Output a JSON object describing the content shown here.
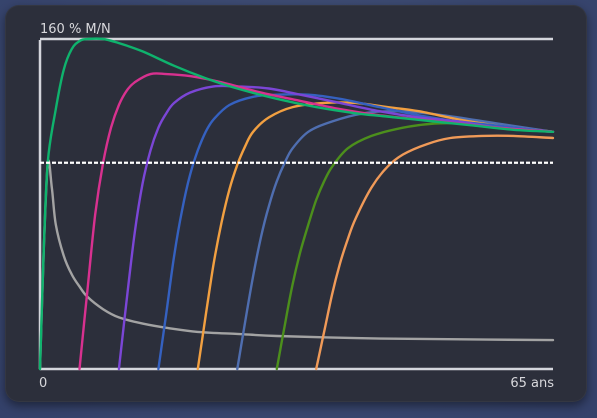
{
  "chart_data": {
    "type": "line",
    "title": "",
    "ylabel": "160 % M/N",
    "x_start_label": "0",
    "x_end_label": "65 ans",
    "xlim": [
      0,
      65
    ],
    "ylim": [
      0,
      160
    ],
    "reference_line": 100,
    "colors": {
      "axis": "#d4d6dc",
      "reference": "#ffffff",
      "grey": "#a3a3a3",
      "series": [
        "#0fb36d",
        "#d8318f",
        "#7b46d6",
        "#3561c0",
        "#f2a041",
        "#4f6eb0",
        "#4c8f1c",
        "#f09a58"
      ]
    },
    "series": [
      {
        "values": [
          [
            0,
            0
          ],
          [
            0.5,
            60
          ],
          [
            1,
            101
          ],
          [
            2,
            126
          ],
          [
            3,
            145
          ],
          [
            4,
            155
          ],
          [
            5,
            159
          ],
          [
            6,
            160
          ],
          [
            8,
            160
          ],
          [
            10,
            158
          ],
          [
            13,
            154
          ],
          [
            17,
            147
          ],
          [
            21,
            141
          ],
          [
            25,
            136
          ],
          [
            30,
            131
          ],
          [
            35,
            127
          ],
          [
            40,
            124
          ],
          [
            45,
            122
          ],
          [
            50,
            120
          ],
          [
            55,
            118
          ],
          [
            60,
            116
          ],
          [
            65,
            115
          ]
        ]
      },
      {
        "values": [
          [
            5,
            0
          ],
          [
            6,
            38
          ],
          [
            7,
            75
          ],
          [
            8,
            100
          ],
          [
            9,
            117
          ],
          [
            10,
            128
          ],
          [
            11,
            135
          ],
          [
            12,
            139
          ],
          [
            14,
            143
          ],
          [
            16,
            143
          ],
          [
            19,
            142
          ],
          [
            23,
            139
          ],
          [
            28,
            134
          ],
          [
            33,
            130
          ],
          [
            38,
            126
          ],
          [
            43,
            123
          ],
          [
            48,
            121
          ],
          [
            53,
            119
          ],
          [
            58,
            117
          ],
          [
            65,
            115
          ]
        ]
      },
      {
        "values": [
          [
            10,
            0
          ],
          [
            11,
            34
          ],
          [
            12,
            66
          ],
          [
            13,
            90
          ],
          [
            14,
            106
          ],
          [
            15,
            117
          ],
          [
            16,
            124
          ],
          [
            17,
            129
          ],
          [
            19,
            134
          ],
          [
            22,
            137
          ],
          [
            25,
            137
          ],
          [
            29,
            136
          ],
          [
            33,
            133
          ],
          [
            38,
            129
          ],
          [
            43,
            125
          ],
          [
            48,
            122
          ],
          [
            53,
            120
          ],
          [
            58,
            117
          ],
          [
            65,
            115
          ]
        ]
      },
      {
        "values": [
          [
            15,
            0
          ],
          [
            16,
            27
          ],
          [
            17,
            55
          ],
          [
            18,
            77
          ],
          [
            19,
            94
          ],
          [
            20,
            106
          ],
          [
            21,
            115
          ],
          [
            22,
            121
          ],
          [
            24,
            128
          ],
          [
            27,
            132
          ],
          [
            30,
            133
          ],
          [
            34,
            133
          ],
          [
            38,
            131
          ],
          [
            43,
            127
          ],
          [
            48,
            123
          ],
          [
            53,
            120
          ],
          [
            58,
            118
          ],
          [
            65,
            115
          ]
        ]
      },
      {
        "values": [
          [
            20,
            0
          ],
          [
            21,
            26
          ],
          [
            22,
            51
          ],
          [
            23,
            71
          ],
          [
            24,
            87
          ],
          [
            25,
            99
          ],
          [
            26,
            108
          ],
          [
            27,
            115
          ],
          [
            29,
            122
          ],
          [
            32,
            127
          ],
          [
            36,
            129
          ],
          [
            40,
            129
          ],
          [
            44,
            127
          ],
          [
            48,
            125
          ],
          [
            53,
            121
          ],
          [
            58,
            118
          ],
          [
            65,
            115
          ]
        ]
      },
      {
        "values": [
          [
            25,
            0
          ],
          [
            26,
            23
          ],
          [
            27,
            45
          ],
          [
            28,
            64
          ],
          [
            29,
            79
          ],
          [
            30,
            91
          ],
          [
            31,
            100
          ],
          [
            32,
            107
          ],
          [
            34,
            115
          ],
          [
            37,
            120
          ],
          [
            41,
            124
          ],
          [
            45,
            125
          ],
          [
            49,
            124
          ],
          [
            53,
            122
          ],
          [
            58,
            119
          ],
          [
            65,
            115
          ]
        ]
      },
      {
        "values": [
          [
            30,
            0
          ],
          [
            31,
            21
          ],
          [
            32,
            41
          ],
          [
            33,
            57
          ],
          [
            34,
            70
          ],
          [
            35,
            82
          ],
          [
            36,
            91
          ],
          [
            37,
            98
          ],
          [
            39,
            107
          ],
          [
            42,
            113
          ],
          [
            46,
            117
          ],
          [
            50,
            119
          ],
          [
            54,
            119
          ],
          [
            58,
            118
          ],
          [
            62,
            116
          ],
          [
            65,
            115
          ]
        ]
      },
      {
        "values": [
          [
            35,
            0
          ],
          [
            36,
            18
          ],
          [
            37,
            36
          ],
          [
            38,
            51
          ],
          [
            39,
            63
          ],
          [
            40,
            73
          ],
          [
            42,
            88
          ],
          [
            44,
            98
          ],
          [
            46,
            104
          ],
          [
            49,
            109
          ],
          [
            52,
            112
          ],
          [
            56,
            113
          ],
          [
            60,
            113
          ],
          [
            65,
            112
          ]
        ]
      }
    ],
    "grey_series": {
      "values": [
        [
          0,
          0
        ],
        [
          0.5,
          60
        ],
        [
          1,
          100
        ],
        [
          1.5,
          88
        ],
        [
          2,
          70
        ],
        [
          3,
          55
        ],
        [
          4,
          46
        ],
        [
          5,
          40
        ],
        [
          6,
          35
        ],
        [
          8,
          29
        ],
        [
          10,
          25
        ],
        [
          13,
          22
        ],
        [
          16,
          20
        ],
        [
          20,
          18
        ],
        [
          25,
          17
        ],
        [
          30,
          16
        ],
        [
          40,
          15
        ],
        [
          50,
          14.5
        ],
        [
          65,
          14
        ]
      ]
    },
    "grid": false
  }
}
